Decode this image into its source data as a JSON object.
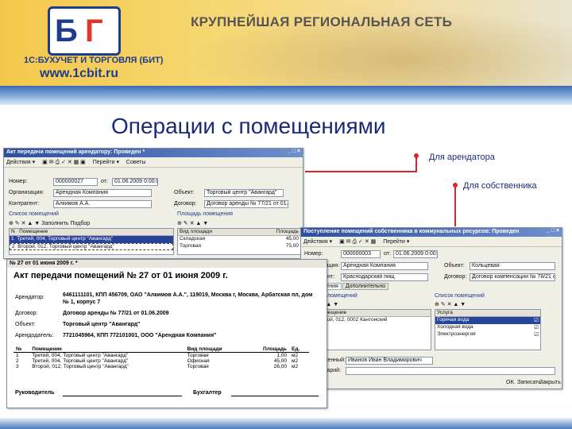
{
  "banner": {
    "logo_b": "Б",
    "logo_t": "Г",
    "company": "1С:БУХУЧЕТ И ТОРГОВЛЯ (БИТ)",
    "url": "www.1cbit.ru",
    "slogan": "КРУПНЕЙШАЯ РЕГИОНАЛЬНАЯ СЕТЬ"
  },
  "page": {
    "title": "Операции с помещениями",
    "callout_tenant": "Для арендатора",
    "callout_owner": "Для собственника"
  },
  "tenant_window": {
    "caption": "Акт передачи помещений арендатору: Проведен *",
    "toolbar": [
      "Действия ▾",
      "Перейти ▾",
      "Советы"
    ],
    "fields": {
      "number_label": "Номер:",
      "number": "000000027",
      "date_label": "от:",
      "date": "01.06.2009 0:00:00",
      "org_label": "Организация:",
      "org": "Арендная Компания",
      "object_label": "Объект:",
      "object": "Торговый центр \"Авангард\"",
      "contractor_label": "Контрагент:",
      "contractor": "Алкимов А.А.",
      "contract_label": "Договор:",
      "contract": "Договор аренды № 77/21 от 01.06.2"
    },
    "section_left": "Список помещений",
    "section_right": "Площадь помещения",
    "left_buttons": [
      "Заполнить",
      "Подбор"
    ],
    "left_columns": [
      "N",
      "Помещение"
    ],
    "left_rows": [
      [
        "1",
        "Третий, 004, Торговый центр \"Авангард\""
      ],
      [
        "2",
        "Второй, 012, Торговый центр \"Авангард\""
      ]
    ],
    "right_columns": [
      "Вид площади",
      "Площадь"
    ],
    "right_rows": [
      [
        "Складская",
        "45,00"
      ],
      [
        "Торговая",
        "75,00"
      ]
    ]
  },
  "act": {
    "caption": "№ 27 от 01 июня 2009 г. *",
    "heading": "Акт передачи помещений № 27 от 01 июня 2009 г.",
    "tenant_label": "Арендатор:",
    "tenant": "6461111101, КПП 456709, ОАО \"Алкимов А.А.\", 119019, Москва г, Москва, Арбатская пл, дом № 1, корпус 7",
    "contract_label": "Договор:",
    "contract": "Договор аренды № 77/21 от 01.06.2009",
    "object_label": "Объект:",
    "object": "Торговый центр \"Авангард\"",
    "lessor_label": "Арендодатель:",
    "lessor": "7721045964, КПП 772101001, ООО \"Арендная Компания\"",
    "columns": [
      "№",
      "Помещение",
      "Вид площади",
      "Площадь",
      "Ед."
    ],
    "rows": [
      [
        "1",
        "Третий, 004, Торговый центр \"Авангард\"",
        "Торговая",
        "1,00",
        "м2"
      ],
      [
        "2",
        "Третий, 004, Торговый центр \"Авангард\"",
        "Офисная",
        "45,00",
        "м2"
      ],
      [
        "3",
        "Второй, 012, Торговый центр \"Авангард\"",
        "Торговая",
        "26,00",
        "м2"
      ]
    ],
    "head_label": "Руководитель",
    "accountant_label": "Бухгалтер"
  },
  "owner_window": {
    "caption": "Поступление помещений собственника в коммунальных ресурсов: Проведен",
    "toolbar": [
      "Действия ▾",
      "Перейти ▾"
    ],
    "fields": {
      "number_label": "Номер:",
      "number": "000000003",
      "date_label": "от:",
      "date": "01.06.2009 0:00:00",
      "org_label": "Организация:",
      "org": "Арендная Компания",
      "object_label": "Объект:",
      "object": "Кольцевая",
      "contractor_label": "Контрагент:",
      "contractor": "Краснодарский пищ",
      "contract_label": "Договор:",
      "contract": "Договор компенсации № 78/21 от 0"
    },
    "tabs": [
      "Помещения",
      "Дополнительно"
    ],
    "left_title": "Список помещений",
    "right_title": "Список помещений",
    "left_columns": [
      "N",
      "Помещение"
    ],
    "left_rows": [
      [
        "1",
        "Второй, 012, 0002 Кантонский"
      ]
    ],
    "right_columns": [
      "Услуга"
    ],
    "right_rows": [
      "Горячая вода",
      "Холодная вода",
      "Электроэнергия"
    ],
    "responsible_label": "Ответственный:",
    "responsible": "Иванов Иван Владимирович",
    "comment_label": "Комментарий:",
    "buttons": [
      "OK",
      "Записать",
      "Закрыть"
    ]
  }
}
